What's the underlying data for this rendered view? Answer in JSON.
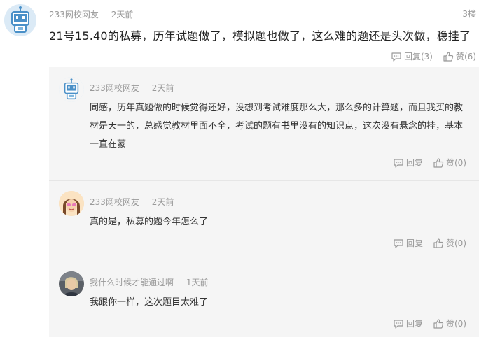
{
  "post": {
    "user": "233网校网友",
    "time": "2天前",
    "floor": "3楼",
    "content": "21号15.40的私募，历年试题做了，模拟题也做了，这么难的题还是头次做，稳挂了",
    "reply_label": "回复",
    "reply_count": "(3)",
    "like_label": "赞",
    "like_count": "(6)"
  },
  "replies": [
    {
      "user": "233网校网友",
      "time": "2天前",
      "content": "同感，历年真题做的时候觉得还好，没想到考试难度那么大，那么多的计算题，而且我买的教材是天一的，总感觉教材里面不全，考试的题有书里没有的知识点，这次没有悬念的挂，基本一直在蒙",
      "reply_label": "回复",
      "like_label": "赞",
      "like_count": "(0)"
    },
    {
      "user": "233网校网友",
      "time": "2天前",
      "content": "真的是，私募的题今年怎么了",
      "reply_label": "回复",
      "like_label": "赞",
      "like_count": "(0)"
    },
    {
      "user": "我什么时候才能通过啊",
      "time": "1天前",
      "content": "我跟你一样，这次题目太难了",
      "reply_label": "回复",
      "like_label": "赞",
      "like_count": "(0)"
    }
  ],
  "icons": {
    "reply": "comment-icon",
    "like": "thumbs-up-icon",
    "avatar_robot": "robot-avatar",
    "avatar_girl": "girl-avatar",
    "avatar_photo": "photo-avatar"
  },
  "colors": {
    "meta_text": "#999999",
    "body_text": "#333333",
    "reply_bg": "#f5f5f5",
    "robot_blue": "#4a90c8"
  }
}
